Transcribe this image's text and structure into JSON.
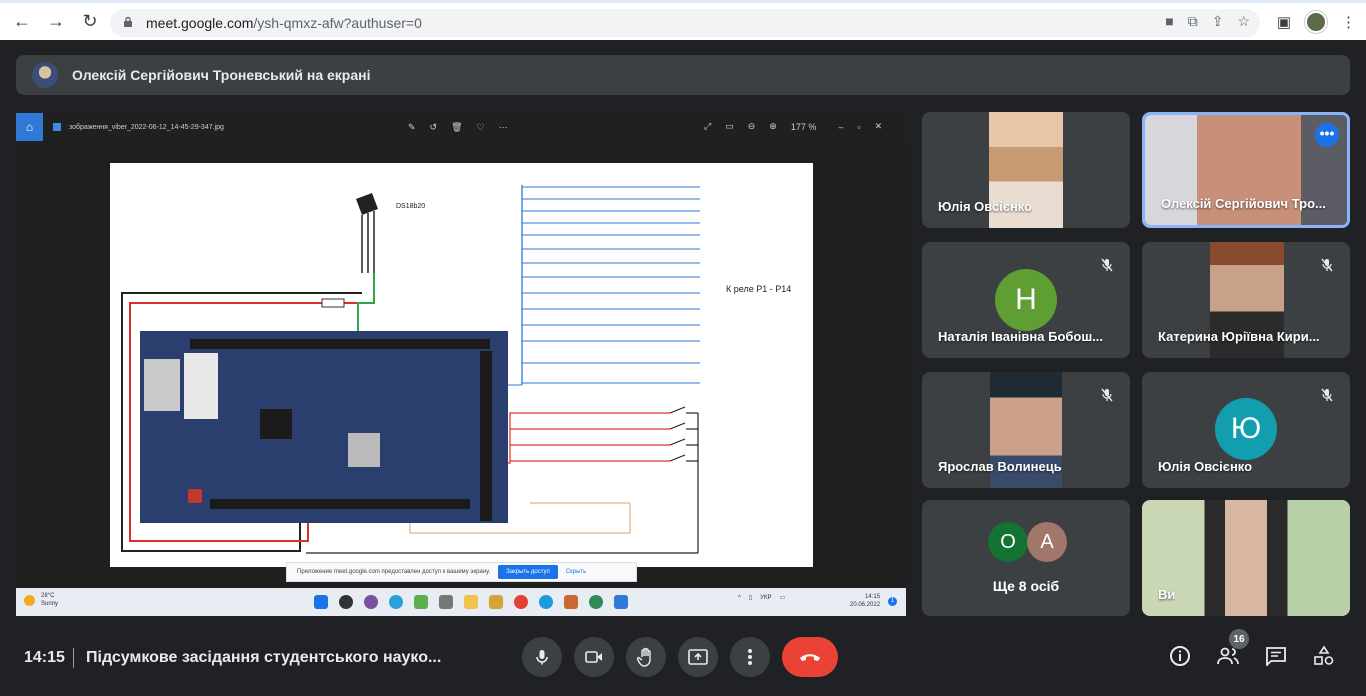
{
  "browser": {
    "url_host": "meet.google.com",
    "url_path": "/ysh-qmxz-afw?authuser=0"
  },
  "banner": {
    "text": "Олексій Сергійович Троневський на екрані"
  },
  "shared_screen": {
    "file_name": "зображення_viber_2022-06-12_14-45-29-347.jpg",
    "zoom": "177 %",
    "sensor_label": "DS18b20",
    "relay_label": "К реле Р1 - Р14",
    "share_message": "Приложение meet.google.com предоставлен доступ к вашему экрану.",
    "stop_share": "Закрыть доступ",
    "hide": "Скрыть",
    "weather_temp": "28°C",
    "weather_desc": "Sunny",
    "tray_lang": "УКР",
    "clock_time": "14:15",
    "clock_date": "20.06.2022",
    "notif_count": "1"
  },
  "tiles": [
    {
      "name": "Юлія Овсієнко"
    },
    {
      "name": "Олексій Сергійович Тро..."
    },
    {
      "name": "Наталія Іванівна Бобош...",
      "initial": "Н"
    },
    {
      "name": "Катерина Юріївна Кири..."
    },
    {
      "name": "Ярослав Волинець"
    },
    {
      "name": "Юлія Овсієнко",
      "initial": "Ю"
    },
    {
      "name": "Ще 8 осіб",
      "initials": [
        "О",
        "А"
      ]
    },
    {
      "name": "Ви"
    }
  ],
  "bottom": {
    "time": "14:15",
    "meeting_title": "Підсумкове засідання студентського науко...",
    "participants_count": "16"
  },
  "colors": {
    "hangup": "#ea4335",
    "accent": "#1a73e8",
    "avatar_n": "#5f9e32",
    "avatar_yu": "#129eaf",
    "avatar_o": "#137333",
    "avatar_a": "#a1766b"
  }
}
